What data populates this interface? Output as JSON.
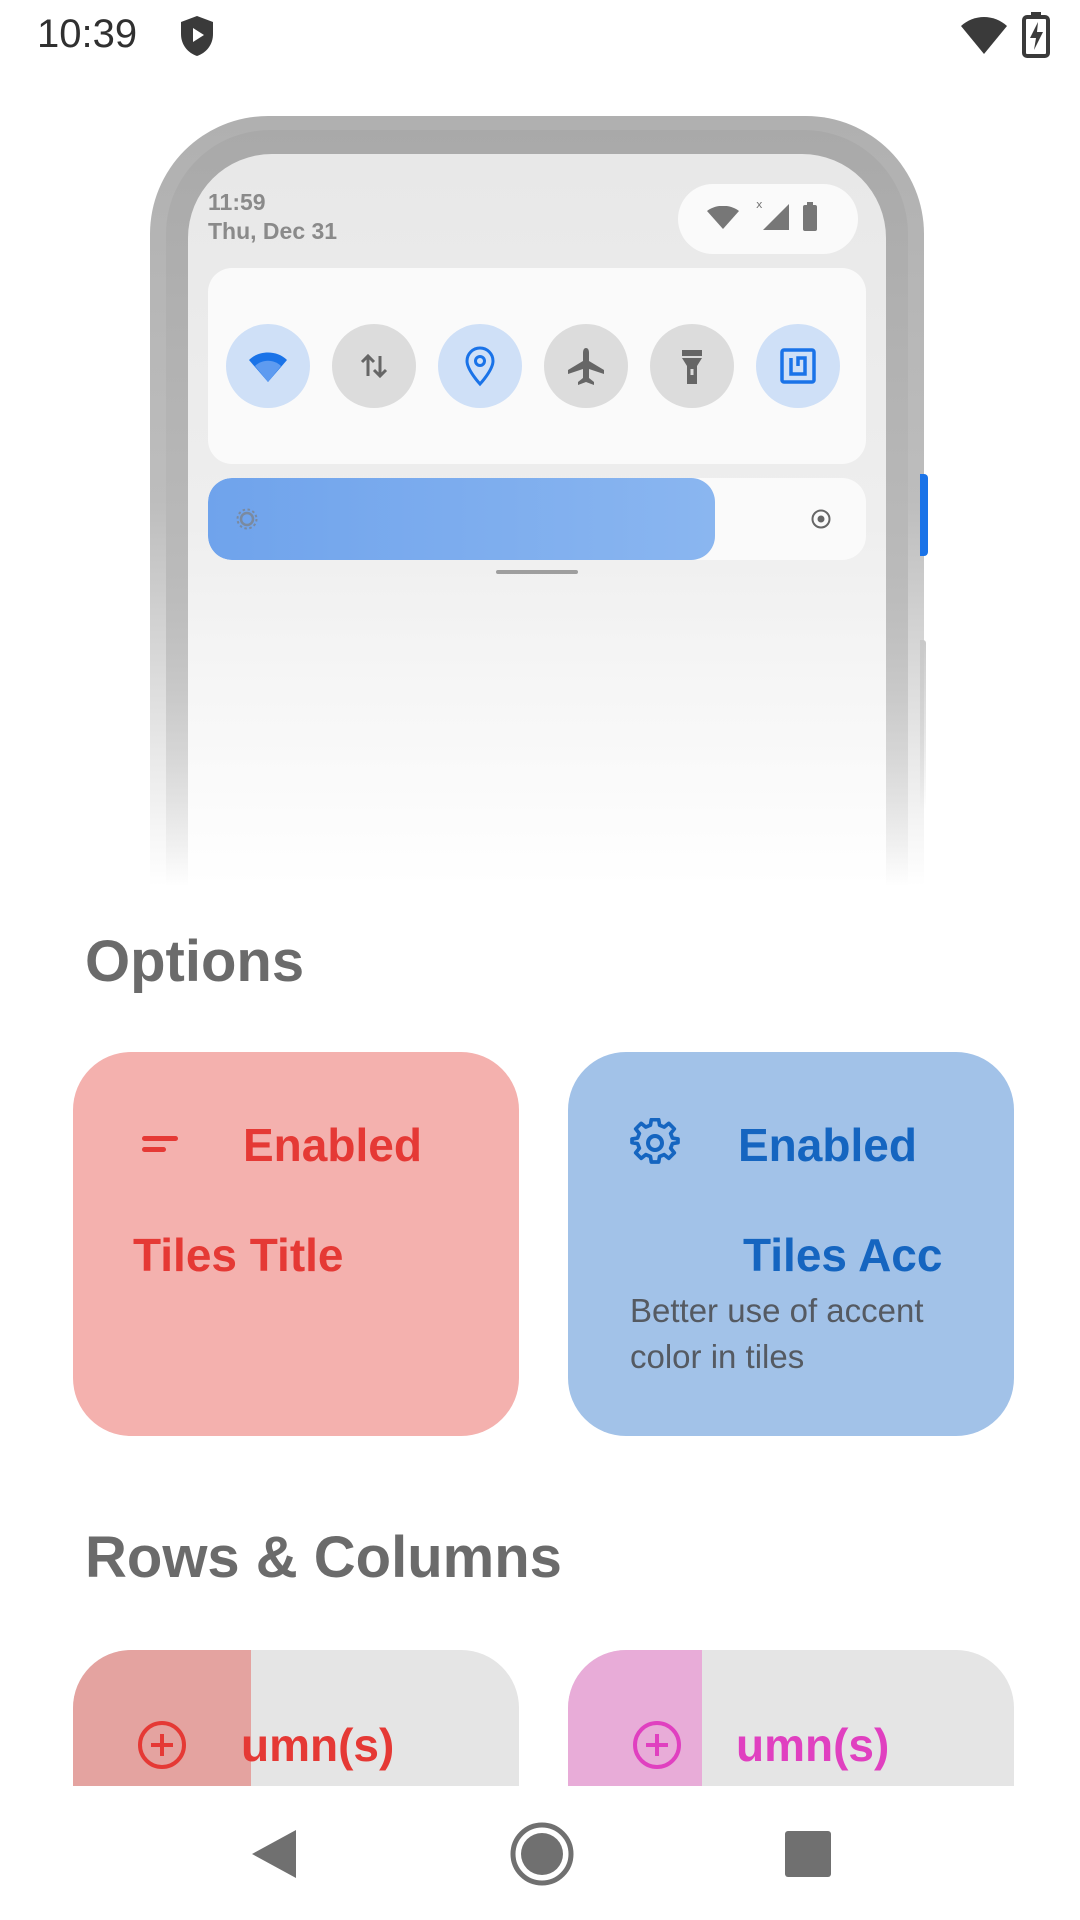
{
  "status_bar": {
    "time": "10:39",
    "icons": [
      "shield-icon",
      "wifi-icon",
      "battery-charging-icon"
    ]
  },
  "preview": {
    "clock_time": "11:59",
    "clock_date": "Thu, Dec 31",
    "status_icons": [
      "wifi-icon",
      "signal-icon",
      "battery-icon"
    ],
    "tiles": [
      {
        "name": "wifi",
        "icon": "wifi-icon",
        "active": true
      },
      {
        "name": "mobile-data",
        "icon": "data-arrows-icon",
        "active": false
      },
      {
        "name": "location",
        "icon": "location-pin-icon",
        "active": true
      },
      {
        "name": "airplane",
        "icon": "airplane-icon",
        "active": false
      },
      {
        "name": "flashlight",
        "icon": "flashlight-icon",
        "active": false
      },
      {
        "name": "nfc",
        "icon": "nfc-icon",
        "active": true
      }
    ],
    "brightness_level": 0.77
  },
  "options": {
    "title": "Options",
    "cards": [
      {
        "status": "Enabled",
        "title": "Tiles Title",
        "icon": "short-text-icon",
        "color": "#e53935"
      },
      {
        "status": "Enabled",
        "title": "Tiles Acc",
        "description": "Better use of accent color in tiles",
        "icon": "gear-icon",
        "color": "#1565c0"
      }
    ]
  },
  "rows_columns": {
    "title": "Rows & Columns",
    "cards": [
      {
        "label": "umn(s)",
        "icon": "add-circle-icon",
        "color": "#e53935",
        "fill_fraction": 0.4
      },
      {
        "label": "umn(s)",
        "icon": "add-circle-icon",
        "color": "#e040c0",
        "fill_fraction": 0.3
      }
    ]
  },
  "navigation": {
    "buttons": [
      "back-icon",
      "home-icon",
      "recents-icon"
    ]
  },
  "colors": {
    "tile_blue": "#1a73e8",
    "card_pink": "#f4b1ae",
    "card_blue": "#a2c2e8",
    "rc_pink_fill": "#e4a3a0",
    "rc_magenta_fill": "#e8acd8"
  }
}
